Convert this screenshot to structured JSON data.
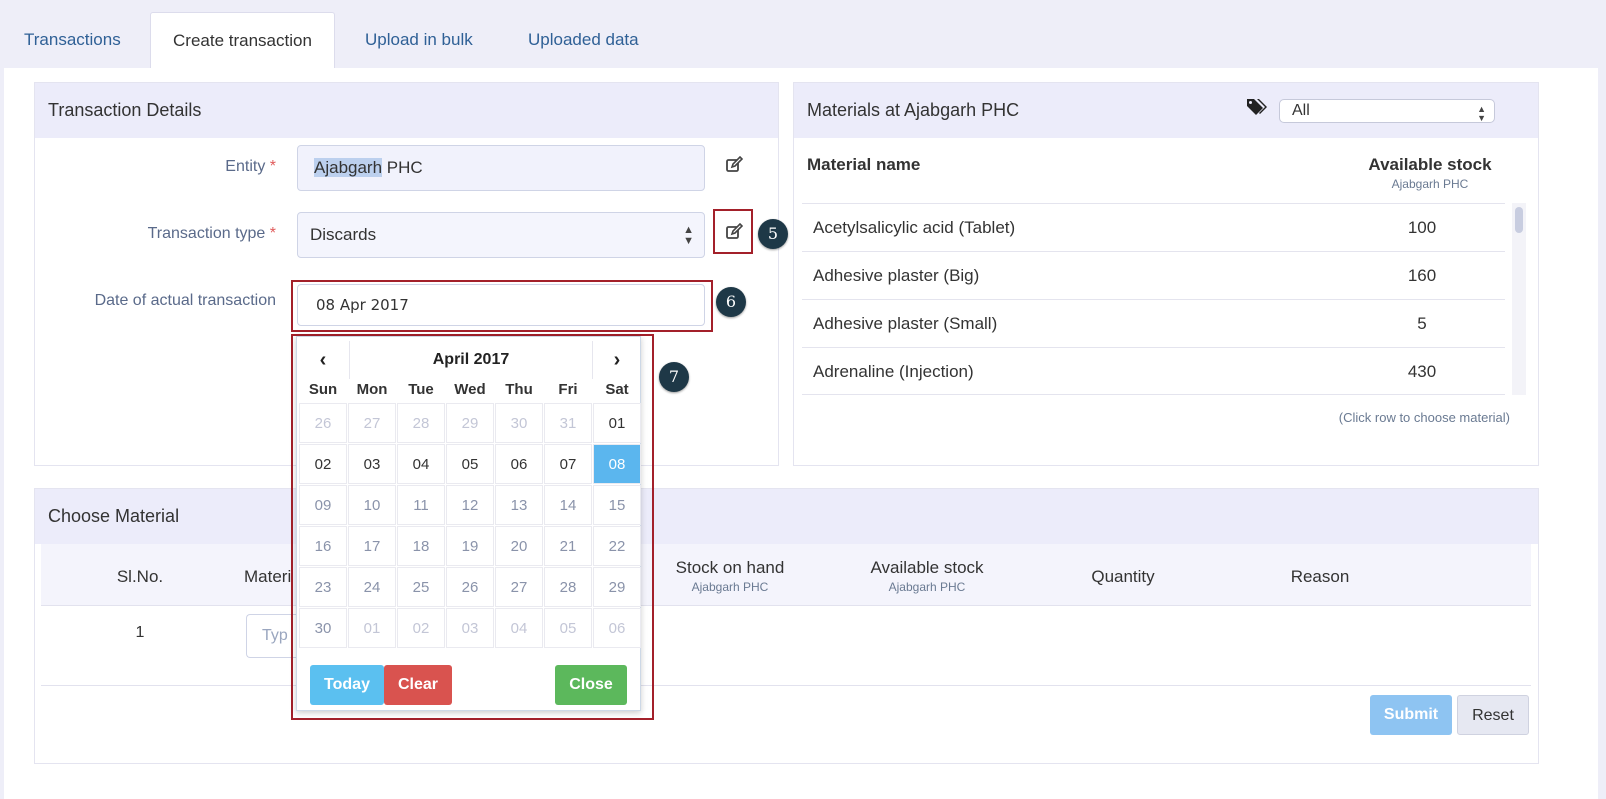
{
  "tabs": [
    "Transactions",
    "Create transaction",
    "Upload in bulk",
    "Uploaded data"
  ],
  "details": {
    "title": "Transaction Details",
    "entity_label": "Entity",
    "entity_value_hl": "Ajabgarh",
    "entity_value_rest": " PHC",
    "type_label": "Transaction type",
    "type_value": "Discards",
    "date_label": "Date of actual transaction",
    "date_value": "08 Apr 2017",
    "required_mark": "*"
  },
  "callouts": [
    "5",
    "6",
    "7"
  ],
  "calendar": {
    "month": "April 2017",
    "prev": "‹",
    "next": "›",
    "dow": [
      "Sun",
      "Mon",
      "Tue",
      "Wed",
      "Thu",
      "Fri",
      "Sat"
    ],
    "weeks": [
      [
        "26",
        "27",
        "28",
        "29",
        "30",
        "31",
        "01"
      ],
      [
        "02",
        "03",
        "04",
        "05",
        "06",
        "07",
        "08"
      ],
      [
        "09",
        "10",
        "11",
        "12",
        "13",
        "14",
        "15"
      ],
      [
        "16",
        "17",
        "18",
        "19",
        "20",
        "21",
        "22"
      ],
      [
        "23",
        "24",
        "25",
        "26",
        "27",
        "28",
        "29"
      ],
      [
        "30",
        "01",
        "02",
        "03",
        "04",
        "05",
        "06"
      ]
    ],
    "selected": "08",
    "today_label": "Today",
    "clear_label": "Clear",
    "close_label": "Close"
  },
  "materials": {
    "title": "Materials at Ajabgarh PHC",
    "filter_value": "All",
    "col_name": "Material name",
    "col_stock": "Available stock",
    "col_stock_sub": "Ajabgarh PHC",
    "rows": [
      {
        "name": "Acetylsalicylic acid (Tablet)",
        "stock": "100"
      },
      {
        "name": "Adhesive plaster (Big)",
        "stock": "160"
      },
      {
        "name": "Adhesive plaster (Small)",
        "stock": "5"
      },
      {
        "name": "Adrenaline (Injection)",
        "stock": "430"
      }
    ],
    "hint": "(Click row to choose material)"
  },
  "choose": {
    "title": "Choose Material",
    "col_slno": "Sl.No.",
    "col_material": "Materi",
    "col_soh": "Stock on hand",
    "col_soh_sub": "Ajabgarh PHC",
    "col_avail": "Available stock",
    "col_avail_sub": "Ajabgarh PHC",
    "col_qty": "Quantity",
    "col_reason": "Reason",
    "row_no": "1",
    "material_placeholder": "Typ",
    "submit_label": "Submit",
    "reset_label": "Reset"
  },
  "colors": {
    "tab_link": "#2f6096",
    "panel_header": "#ececfa",
    "callout_border": "#a3202a",
    "calendar_selected": "#5bb6ee",
    "today_button": "#5bc0f0",
    "clear_button": "#d9534f",
    "close_button": "#5cb85c",
    "submit_button": "#8ec4f2"
  }
}
